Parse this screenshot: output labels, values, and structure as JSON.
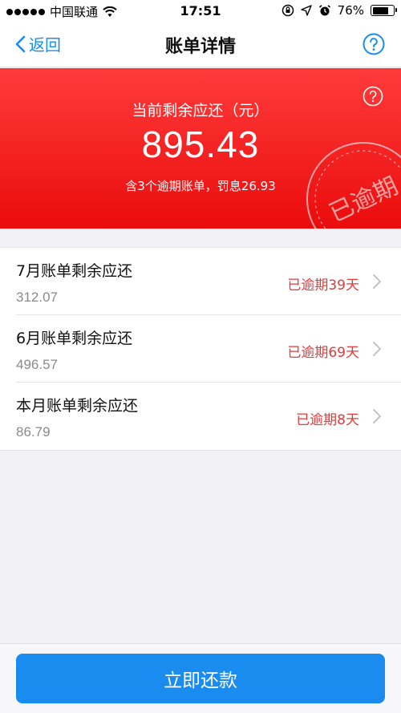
{
  "status_bar": {
    "carrier": "中国联通",
    "time": "17:51",
    "battery": "76%",
    "battery_level": 0.76
  },
  "nav": {
    "back_label": "返回",
    "title": "账单详情",
    "help_icon": "question-circle-icon"
  },
  "summary": {
    "label": "当前剩余应还（元）",
    "amount": "895.43",
    "note": "含3个逾期账单，罚息26.93",
    "stamp_text": "已逾期",
    "help_icon": "question-circle-icon"
  },
  "bills": [
    {
      "title": "7月账单剩余应还",
      "amount": "312.07",
      "status": "已逾期39天"
    },
    {
      "title": "6月账单剩余应还",
      "amount": "496.57",
      "status": "已逾期69天"
    },
    {
      "title": "本月账单剩余应还",
      "amount": "86.79",
      "status": "已逾期8天"
    }
  ],
  "action": {
    "pay_label": "立即还款"
  },
  "colors": {
    "accent": "#1a8cf0",
    "alert_red": "#ea0c0c",
    "overdue_text": "#e33a3a"
  }
}
